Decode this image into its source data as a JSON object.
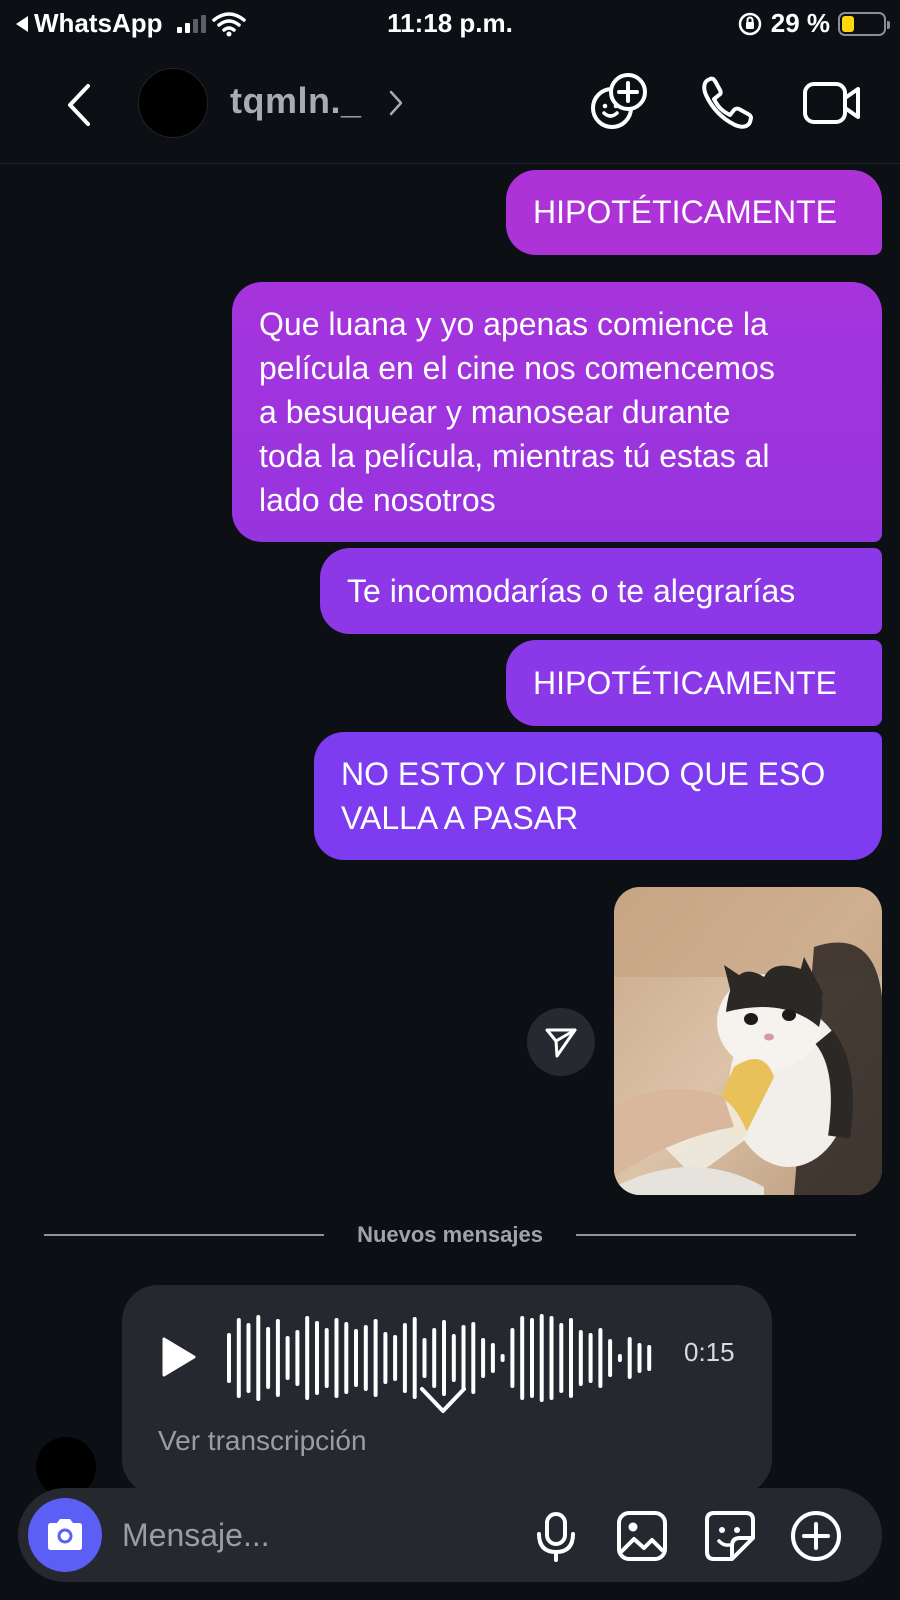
{
  "status_bar": {
    "back_app": "WhatsApp",
    "time": "11:18 p.m.",
    "battery": "29 %"
  },
  "header": {
    "contact_name": "tqmln._",
    "icons": [
      "back-icon",
      "chevron-right-icon",
      "effects-add-icon",
      "phone-icon",
      "video-camera-icon"
    ]
  },
  "messages": [
    {
      "text": "HIPOTÉTICAMENTE"
    },
    {
      "lines": [
        "Que luana y yo apenas comience la",
        "película en el cine nos comencemos",
        "a besuquear y manosear durante",
        "toda la película, mientras tú estas al",
        "lado de nosotros"
      ]
    },
    {
      "text": "Te incomodarías o te alegrarías"
    },
    {
      "text": "HIPOTÉTICAMENTE"
    },
    {
      "lines": [
        "NO ESTOY DICIENDO QUE ESO",
        "VALLA A PASAR"
      ]
    }
  ],
  "divider": {
    "label": "Nuevos mensajes"
  },
  "voice_message": {
    "duration": "0:15",
    "transcript_label": "Ver transcripción"
  },
  "composer": {
    "placeholder": "Mensaje...",
    "icons": [
      "camera-icon",
      "microphone-icon",
      "gallery-icon",
      "sticker-icon",
      "plus-circle-icon"
    ]
  },
  "colors": {
    "accent_pink": "#ad33d9",
    "accent_purple": "#7d3cf0",
    "camera_button": "#5b5ff6",
    "background": "#0c0f14"
  }
}
